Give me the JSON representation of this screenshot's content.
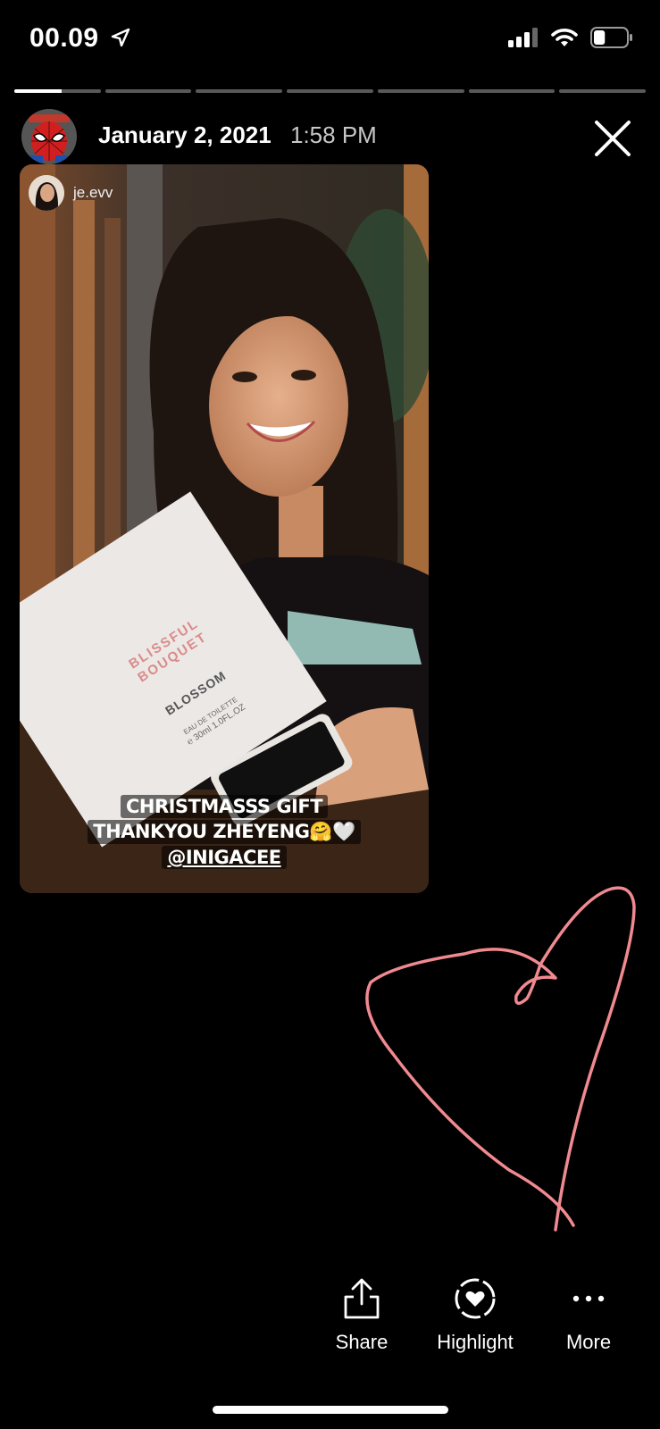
{
  "status_bar": {
    "time": "00.09",
    "battery_level": 0.35
  },
  "progress": {
    "segments": 7,
    "current": 0,
    "current_fill": 0.55
  },
  "header": {
    "date": "January 2, 2021",
    "time": "1:58 PM"
  },
  "story": {
    "username": "je.evv",
    "caption_lines": [
      "CHRISTMASSS GIFT",
      "THANKYOU ZHEYENG🤗🤍",
      "@INIGACEE"
    ],
    "box_brand": "BLISSFUL BOUQUET",
    "box_name": "BLOSSOM",
    "box_type": "EAU DE TOILETTE",
    "box_volume": "℮ 30ml 1.0FL.OZ"
  },
  "actions": {
    "share": "Share",
    "highlight": "Highlight",
    "more": "More"
  },
  "colors": {
    "heart_doodle": "#f08a90",
    "background": "#000000"
  }
}
